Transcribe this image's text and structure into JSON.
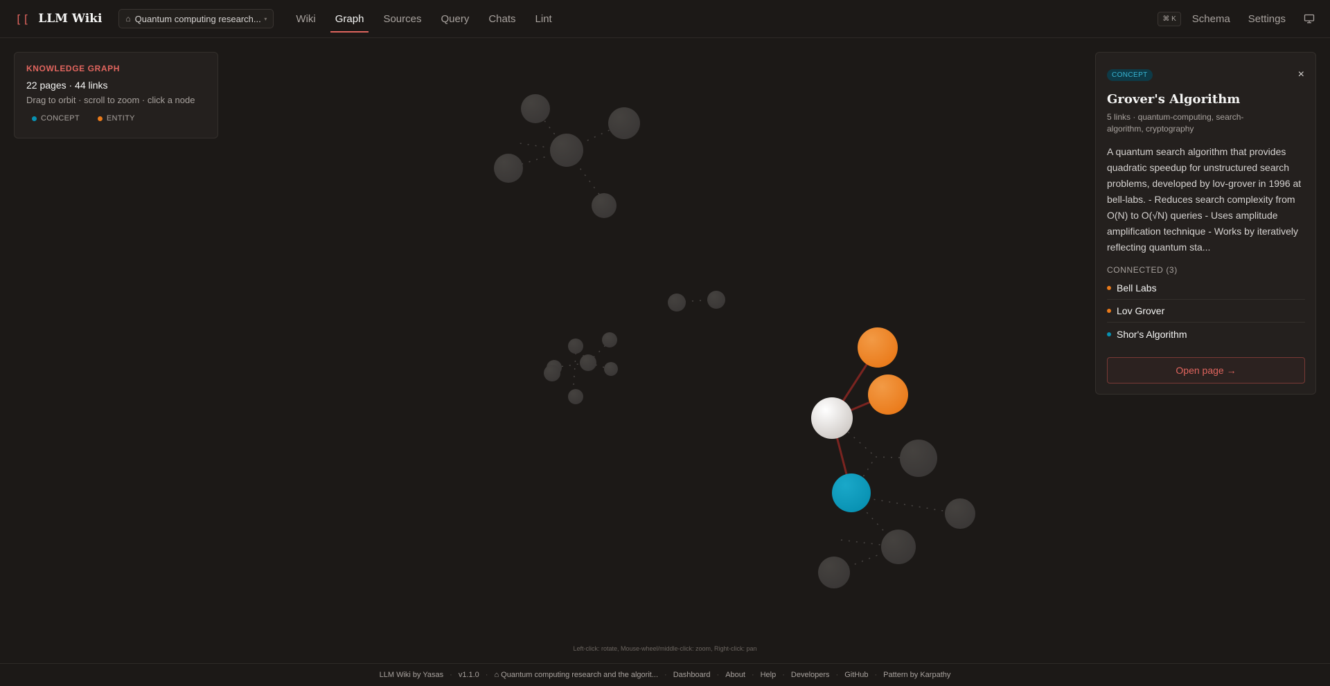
{
  "app": {
    "logo_mark": "[[",
    "logo_text": "LLM Wiki"
  },
  "project": {
    "home_icon": "home-icon",
    "name": "Quantum computing research...",
    "caret": "▾"
  },
  "nav": {
    "items": [
      "Wiki",
      "Graph",
      "Sources",
      "Query",
      "Chats",
      "Lint"
    ],
    "active": "Graph"
  },
  "header_right": {
    "shortcut": "⌘ K",
    "schema": "Schema",
    "settings": "Settings",
    "display_icon": "monitor-icon"
  },
  "info_card": {
    "title": "KNOWLEDGE GRAPH",
    "stats": "22 pages · 44 links",
    "hint": "Drag to orbit · scroll to zoom · click a node",
    "legend": [
      {
        "label": "CONCEPT",
        "color": "#0891b2"
      },
      {
        "label": "ENTITY",
        "color": "#ea7a1a"
      }
    ]
  },
  "graph": {
    "hint": "Left-click: rotate, Mouse-wheel/middle-click: zoom, Right-click: pan",
    "colors": {
      "concept": "#0891b2",
      "entity": "#ea7a1a",
      "selected": "#e7e5e4",
      "dim": "#3a3736",
      "link_active": "#7a2420"
    }
  },
  "panel": {
    "badge": "CONCEPT",
    "close": "×",
    "title": "Grover's Algorithm",
    "meta": "5 links · quantum-computing, search-algorithm, cryptography",
    "body": "A quantum search algorithm that provides quadratic speedup for unstructured search problems, developed by lov-grover in 1996 at bell-labs. - Reduces search complexity from O(N) to O(√N) queries - Uses amplitude amplification technique - Works by iteratively reflecting quantum sta...",
    "connected_header": "CONNECTED (3)",
    "connected": [
      {
        "label": "Bell Labs",
        "color": "#ea7a1a"
      },
      {
        "label": "Lov Grover",
        "color": "#ea7a1a"
      },
      {
        "label": "Shor's Algorithm",
        "color": "#0891b2"
      }
    ],
    "open_button": "Open page →"
  },
  "footer": {
    "items": [
      "LLM Wiki by Yasas",
      "v1.1.0",
      "⌂ Quantum computing research and the algorit...",
      "Dashboard",
      "About",
      "Help",
      "Developers",
      "GitHub",
      "Pattern by Karpathy"
    ]
  }
}
